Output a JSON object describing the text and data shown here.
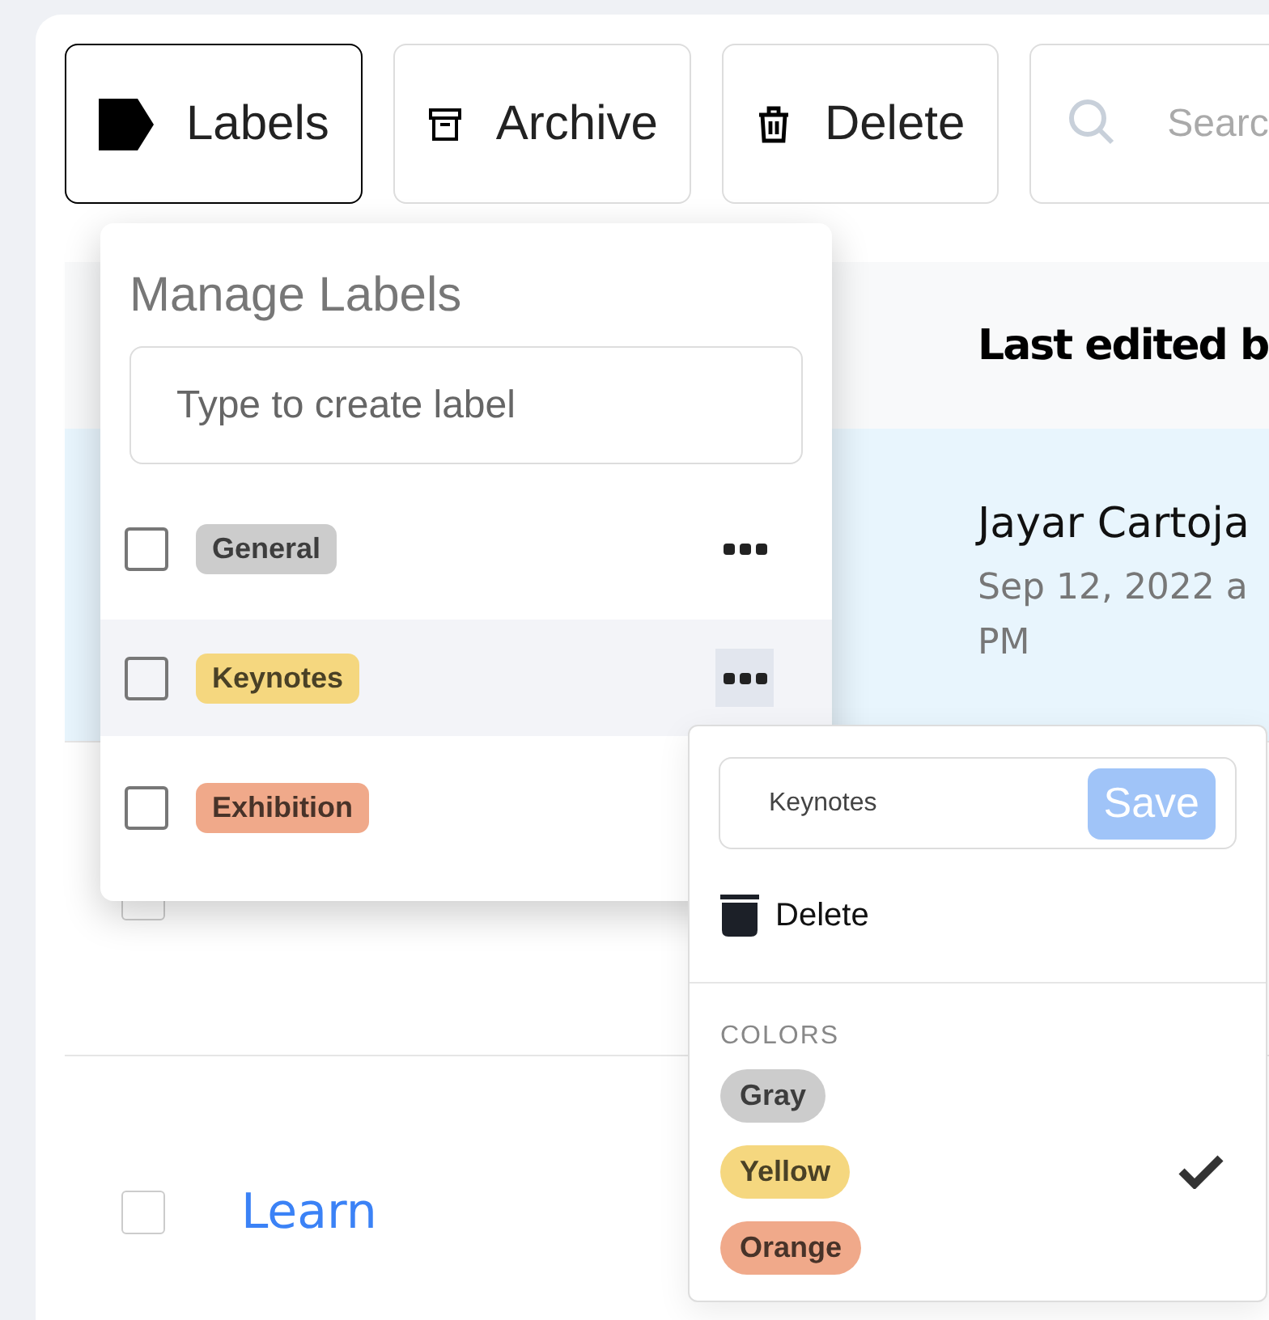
{
  "toolbar": {
    "buttons": [
      {
        "label": "Labels",
        "kind": "tag",
        "selected": true
      },
      {
        "label": "Archive",
        "kind": "archive",
        "selected": false
      },
      {
        "label": "Delete",
        "kind": "trash",
        "selected": false
      }
    ],
    "search": {
      "placeholder": "Searc"
    }
  },
  "table": {
    "columns": [
      {
        "label": "Last edited b"
      }
    ],
    "rows": [
      {
        "selected": true,
        "editor": "Jayar Cartoja",
        "date": "Sep 12, 2022 a PM"
      },
      {
        "selected": false,
        "checked": false
      },
      {
        "selected": false,
        "name": "Learn",
        "checked": false
      }
    ]
  },
  "manage_labels": {
    "title": "Manage Labels",
    "placeholder": "Type to create label",
    "labels": [
      {
        "name": "General",
        "color": "#cccccc",
        "checked": false,
        "selected": false
      },
      {
        "name": "Keynotes",
        "color": "#f5d77f",
        "checked": false,
        "selected": true
      },
      {
        "name": "Exhibition",
        "color": "#f0a98a",
        "checked": false,
        "selected": false
      }
    ]
  },
  "label_menu": {
    "value": "Keynotes",
    "save": {
      "label": "Save",
      "disabled": true
    },
    "delete": "Delete",
    "colors_heading": "COLORS",
    "colors": [
      {
        "name": "Gray",
        "color": "#cccccc",
        "selected": false
      },
      {
        "name": "Yellow",
        "color": "#f5d77f",
        "selected": true
      },
      {
        "name": "Orange",
        "color": "#f0a98a",
        "selected": false
      }
    ]
  }
}
